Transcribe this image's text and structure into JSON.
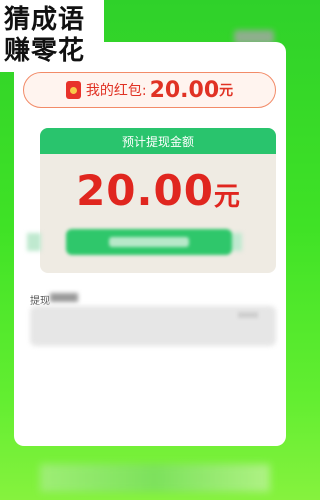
{
  "banner": {
    "line1": "猜成语",
    "line2": "赚零花"
  },
  "redpack": {
    "label": "我的红包:",
    "amount": "20.00",
    "unit": "元",
    "icon": "red-envelope-icon"
  },
  "panel": {
    "header": "预计提现金额",
    "amount": "20.00",
    "unit": "元"
  },
  "record": {
    "label": "提现"
  },
  "colors": {
    "background": "#3fe226",
    "accent_green": "#29c46d",
    "amount_red": "#e0261f"
  }
}
